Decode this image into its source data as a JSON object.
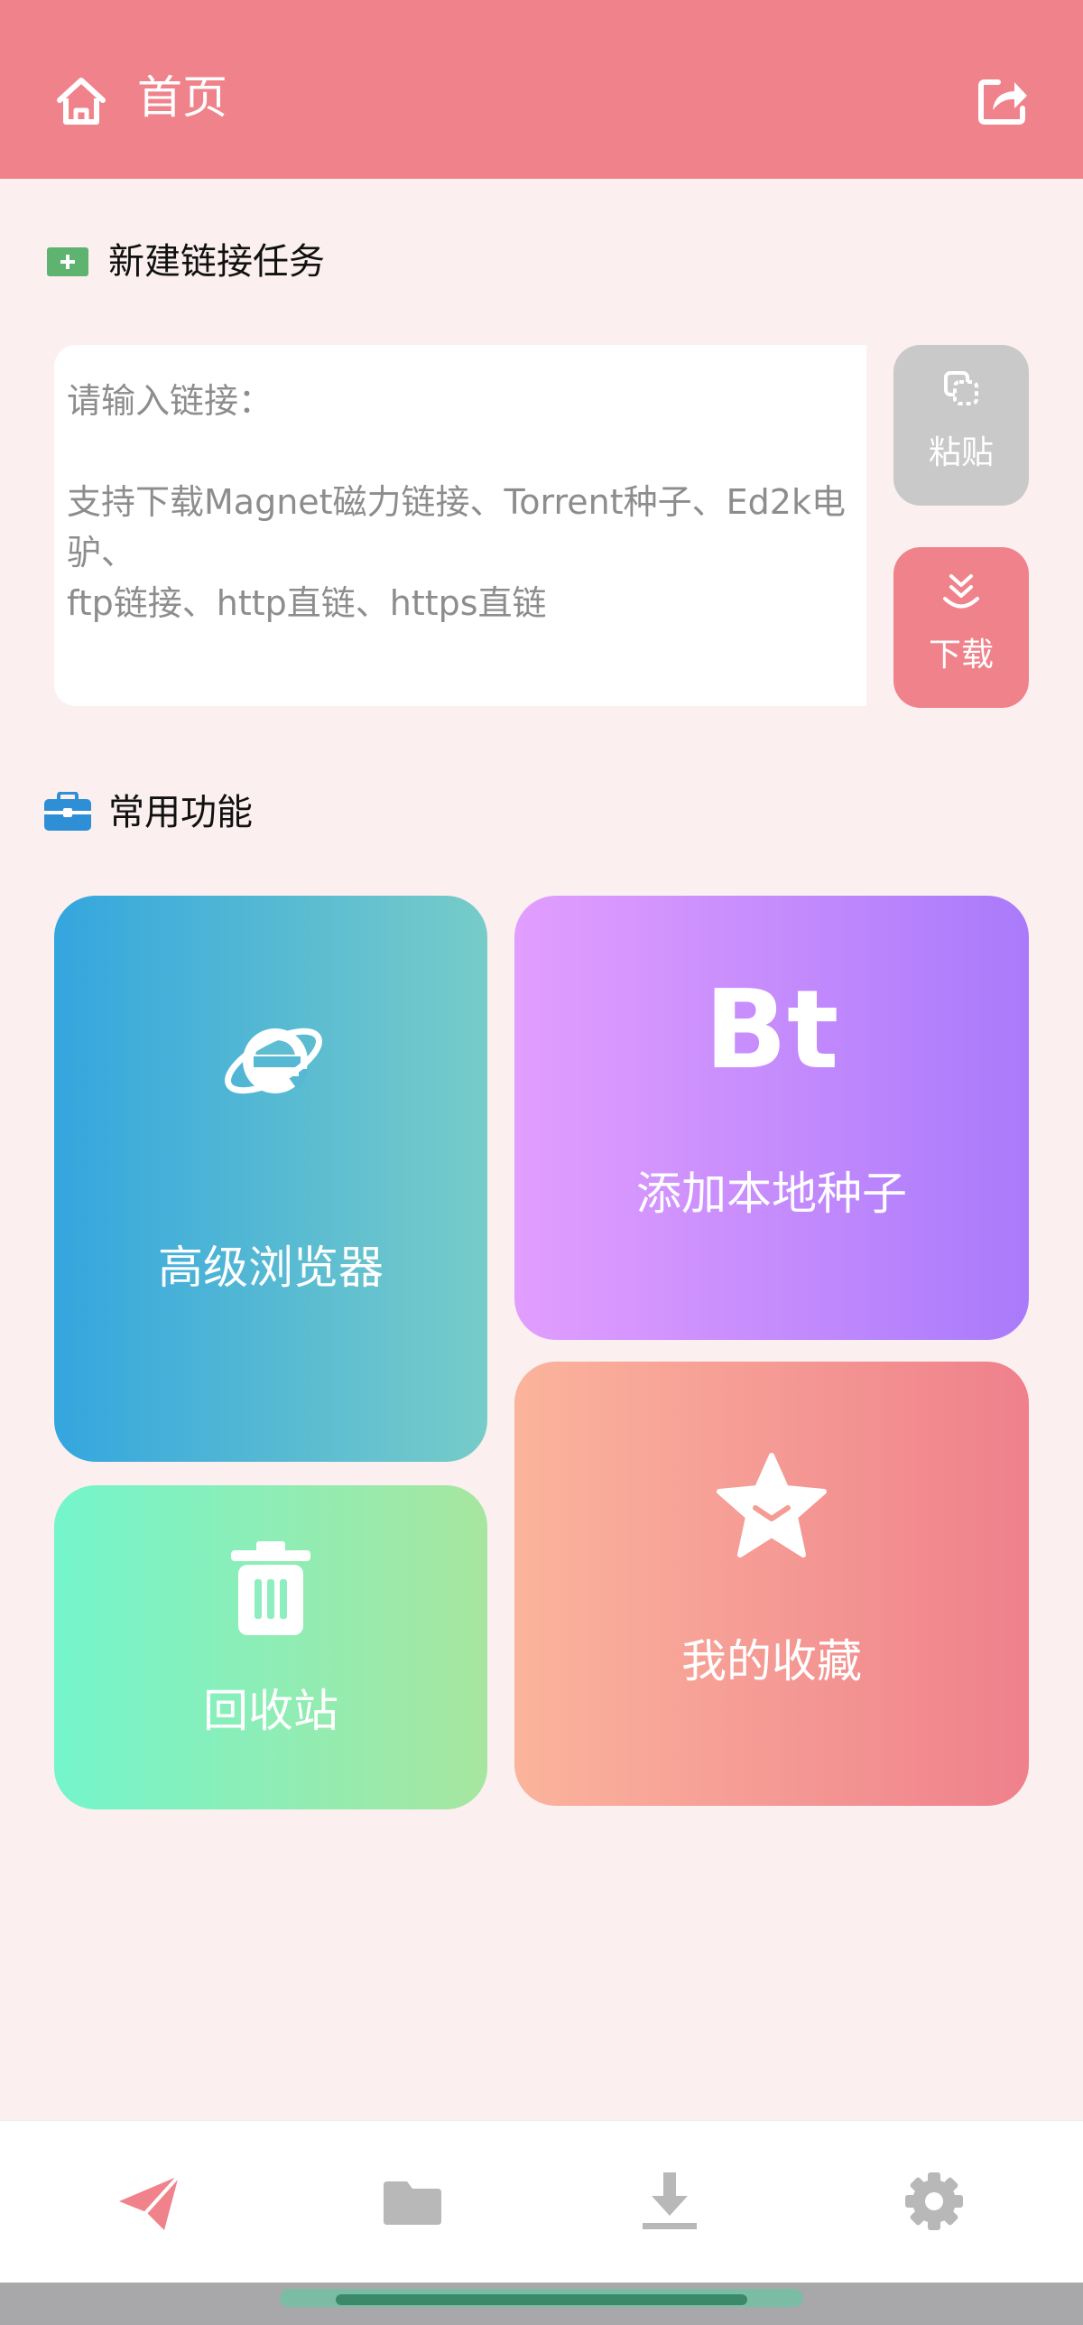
{
  "header": {
    "title": "首页",
    "home_icon": "home-icon",
    "share_icon": "share-icon",
    "color": "#f0828b"
  },
  "new_task": {
    "title": "新建链接任务",
    "placeholder": "请输入链接：\n\n支持下载Magnet磁力链接、Torrent种子、Ed2k电驴、\nftp链接、http直链、https直链",
    "paste_label": "粘贴",
    "download_label": "下载"
  },
  "common": {
    "title": "常用功能",
    "cards": {
      "browser": "高级浏览器",
      "bt_mark": "Bt",
      "bt": "添加本地种子",
      "trash": "回收站",
      "favorites": "我的收藏"
    }
  },
  "bottom_nav": {
    "items": [
      {
        "icon": "send-icon",
        "active": true
      },
      {
        "icon": "folder-icon",
        "active": false
      },
      {
        "icon": "download-icon",
        "active": false
      },
      {
        "icon": "settings-icon",
        "active": false
      }
    ],
    "active_color": "#f0828b",
    "inactive_color": "#b8b8b8"
  }
}
